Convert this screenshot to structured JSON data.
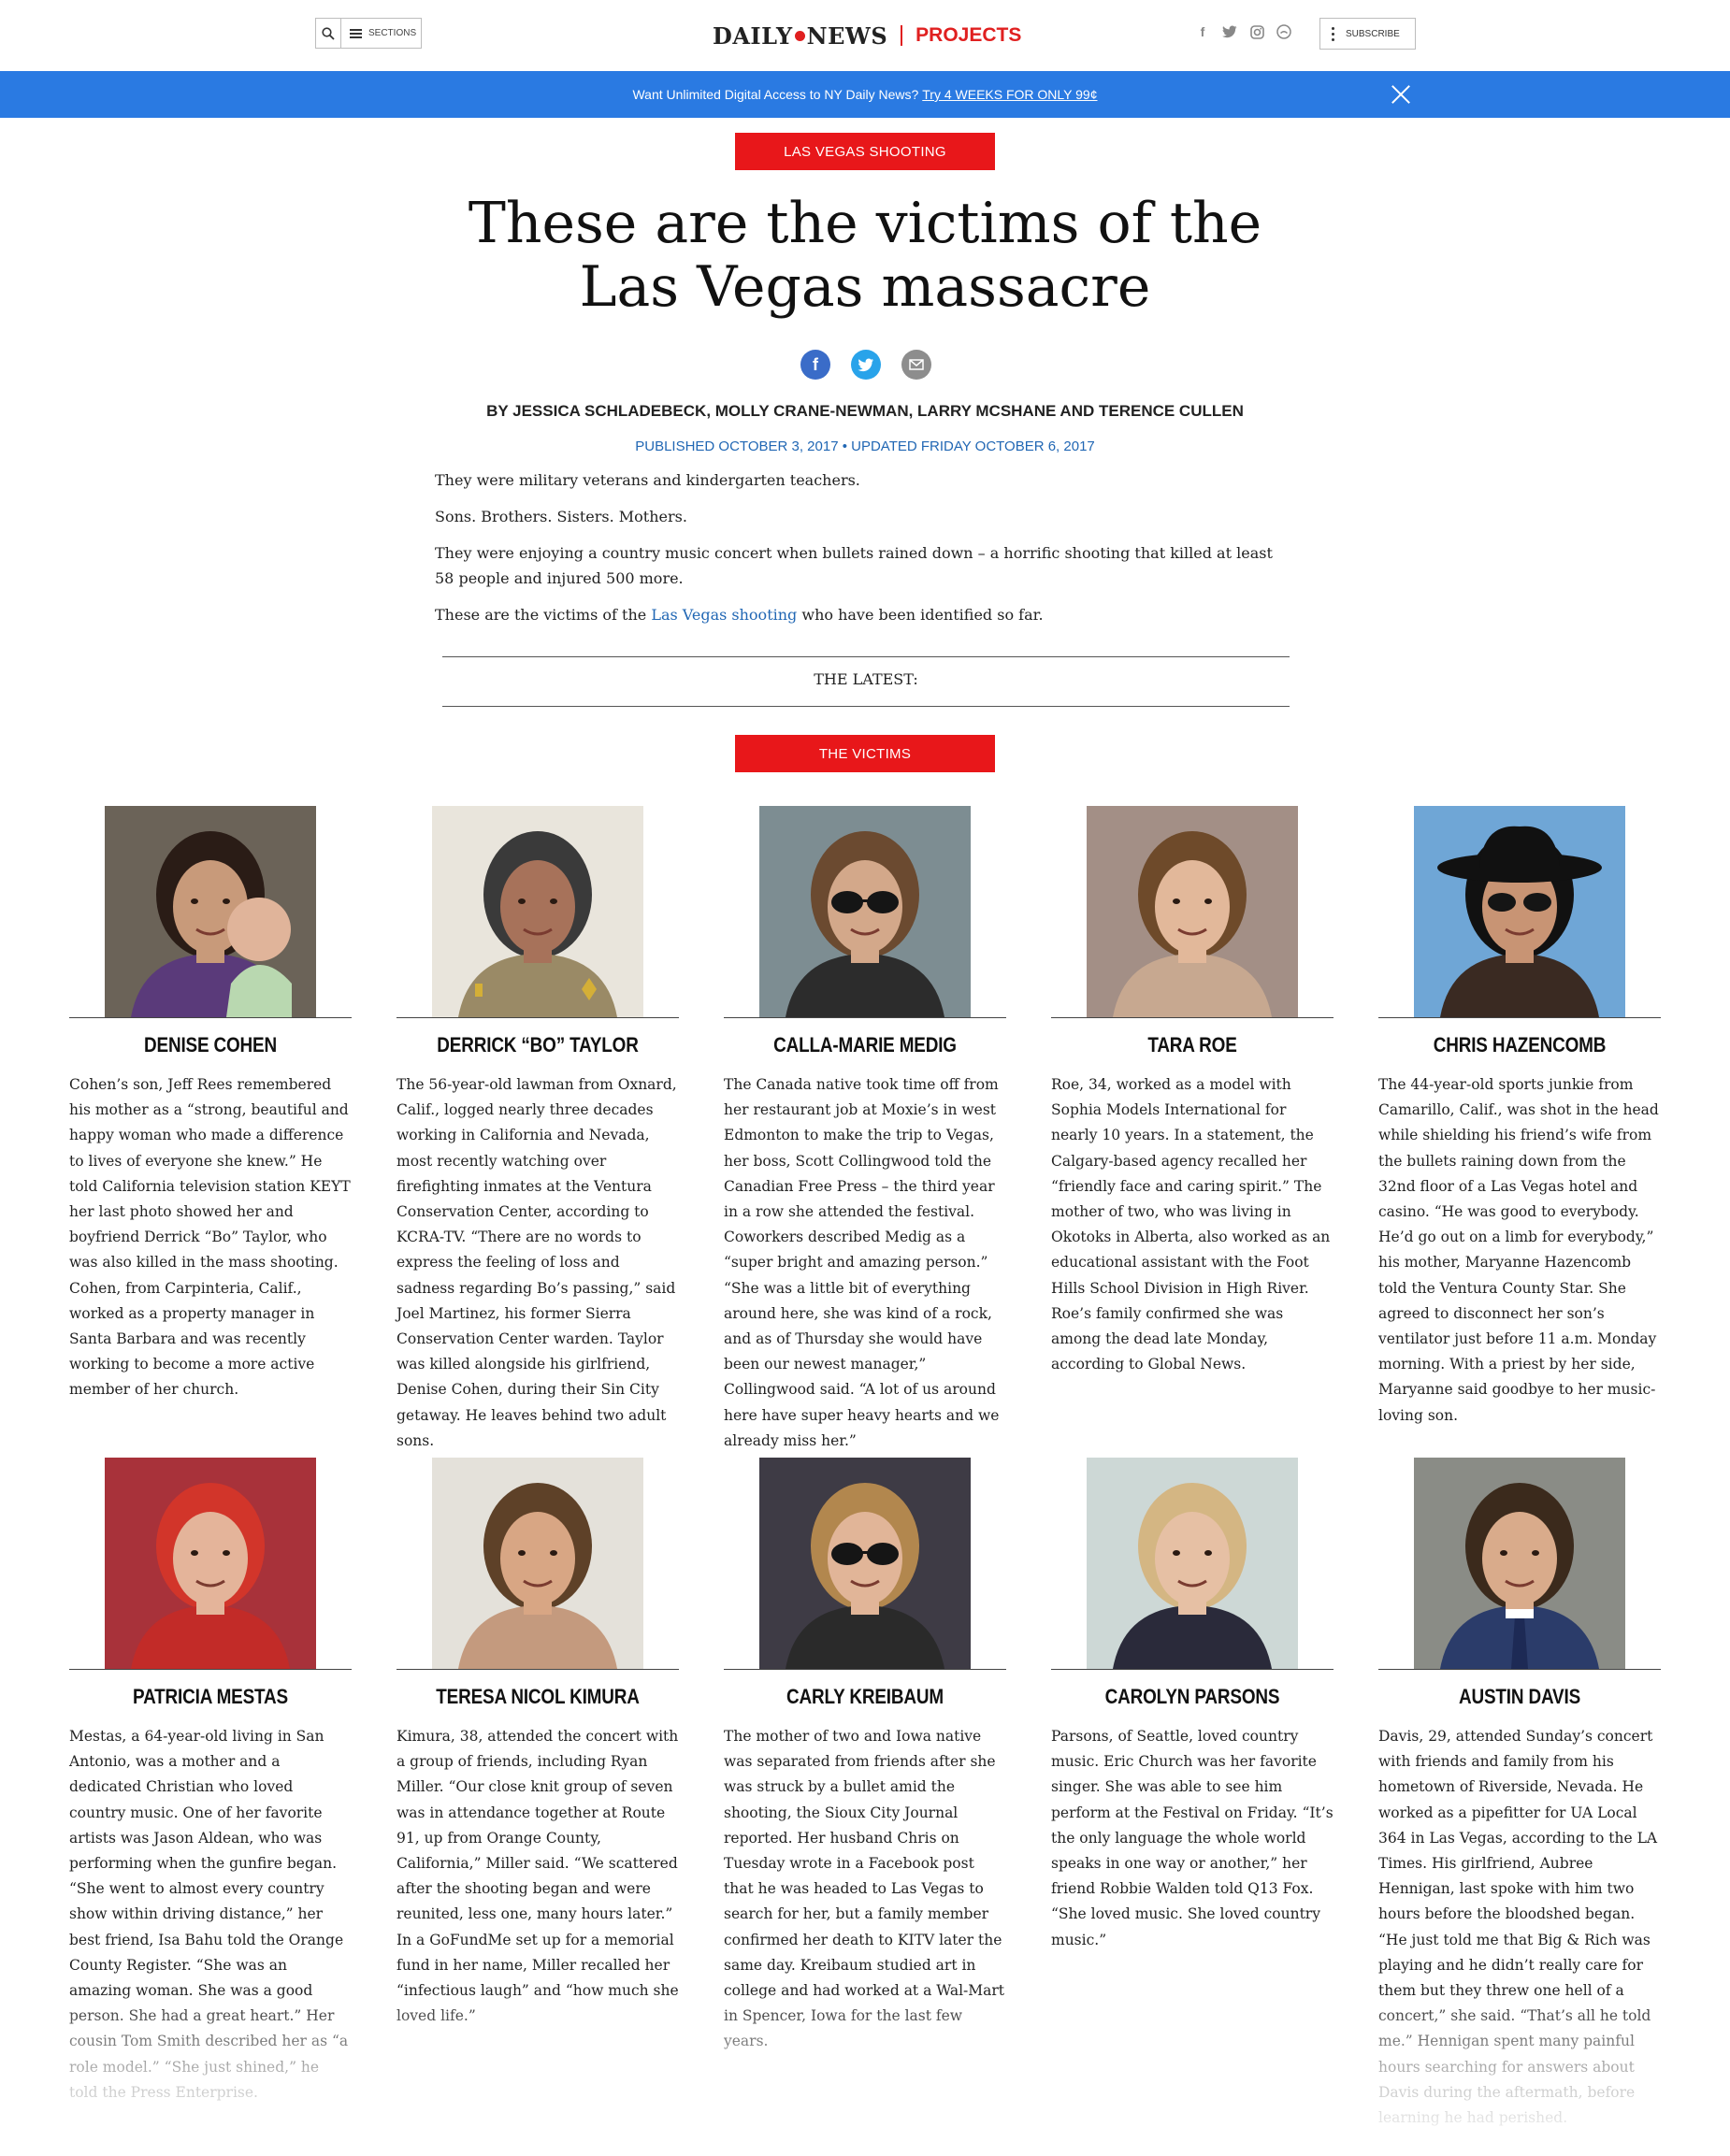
{
  "header": {
    "sections_label": "SECTIONS",
    "logo_left": "DAILY",
    "logo_right": "NEWS",
    "projects_label": "PROJECTS",
    "subscribe_label": "SUBSCRIBE",
    "social": [
      "facebook-icon",
      "twitter-icon",
      "instagram-icon",
      "other-icon"
    ]
  },
  "promo": {
    "text": "Want Unlimited Digital Access to NY Daily News?",
    "link": "Try 4 WEEKS FOR ONLY 99¢"
  },
  "article": {
    "tag": "LAS VEGAS SHOOTING",
    "headline_line1": "These are the victims of the",
    "headline_line2": "Las Vegas massacre",
    "byline": "BY JESSICA SCHLADEBECK, MOLLY CRANE-NEWMAN, LARRY MCSHANE AND TERENCE CULLEN",
    "dateline": "PUBLISHED OCTOBER 3, 2017 • UPDATED FRIDAY OCTOBER 6, 2017",
    "intro": {
      "p1": "They were military veterans and kindergarten teachers.",
      "p2": "Sons. Brothers. Sisters. Mothers.",
      "p3": "They were enjoying a country music concert when bullets rained down – a horrific shooting that killed at least 58 people and injured 500 more.",
      "p4_before": "These are the victims of the ",
      "p4_link": "Las Vegas shooting",
      "p4_after": " who have been identified so far."
    },
    "latest_label": "THE LATEST:",
    "victims_tag": "THE VICTIMS"
  },
  "colors": {
    "brand_red": "#e8171a",
    "banner_blue": "#2a7ae2",
    "link_blue": "#2167b4"
  },
  "victims": [
    {
      "name": "DENISE COHEN",
      "bio": "Cohen’s son, Jeff Rees remembered his mother as a “strong, beautiful and happy woman who made a difference to lives of everyone she knew.” He told California television station KEYT her last photo showed her and boyfriend Derrick “Bo” Taylor, who was also killed in the mass shooting. Cohen, from Carpinteria, Calif., worked as a property manager in Santa Barbara and was recently working to become a more active member of her church."
    },
    {
      "name": "DERRICK “BO” TAYLOR",
      "bio": "The 56-year-old lawman from Oxnard, Calif., logged nearly three decades working in California and Nevada, most recently watching over firefighting inmates at the Ventura Conservation Center, according to KCRA-TV. “There are no words to express the feeling of loss and sadness regarding Bo’s passing,” said Joel Martinez, his former Sierra Conservation Center warden. Taylor was killed alongside his girlfriend, Denise Cohen, during their Sin City getaway. He leaves behind two adult sons."
    },
    {
      "name": "CALLA-MARIE MEDIG",
      "bio": "The Canada native took time off from her restaurant job at Moxie’s in west Edmonton to make the trip to Vegas, her boss, Scott Collingwood told the Canadian Free Press – the third year in a row she attended the festival. Coworkers described Medig as a “super bright and amazing person.” “She was a little bit of everything around here, she was kind of a rock, and as of Thursday she would have been our newest manager,” Collingwood said. “A lot of us around here have super heavy hearts and we already miss her.”"
    },
    {
      "name": "TARA ROE",
      "bio": "Roe, 34, worked as a model with Sophia Models International for nearly 10 years. In a statement, the Calgary-based agency recalled her “friendly face and caring spirit.” The mother of two, who was living in Okotoks in Alberta, also worked as an educational assistant with the Foot Hills School Division in High River. Roe’s family confirmed she was among the dead late Monday, according to Global News."
    },
    {
      "name": "CHRIS HAZENCOMB",
      "bio": "The 44-year-old sports junkie from Camarillo, Calif., was shot in the head while shielding his friend’s wife from the bullets raining down from the 32nd floor of a Las Vegas hotel and casino. “He was good to everybody. He’d go out on a limb for everybody,” his mother, Maryanne Hazencomb told the Ventura County Star. She agreed to disconnect her son’s ventilator just before 11 a.m. Monday morning. With a priest by her side, Maryanne said goodbye to her music-loving son."
    },
    {
      "name": "PATRICIA MESTAS",
      "bio": "Mestas, a 64-year-old living in San Antonio, was a mother and a dedicated Christian who loved country music. One of her favorite artists was Jason Aldean, who was performing when the gunfire began. “She went to almost every country show within driving distance,” her best friend, Isa Bahu told the Orange County Register. “She was an amazing woman. She was a good person. She had a great heart.” Her cousin Tom Smith described her as “a role model.” “She just shined,” he told the Press Enterprise."
    },
    {
      "name": "TERESA NICOL KIMURA",
      "bio": "Kimura, 38, attended the concert with a group of friends, including Ryan Miller. “Our close knit group of seven was in attendance together at Route 91, up from Orange County, California,” Miller said. “We scattered after the shooting began and were reunited, less one, many hours later.” In a GoFundMe set up for a memorial fund in her name, Miller recalled her “infectious laugh” and “how much she loved life.”"
    },
    {
      "name": "CARLY KREIBAUM",
      "bio": "The mother of two and Iowa native was separated from friends after she was struck by a bullet amid the shooting, the Sioux City Journal reported. Her husband Chris on Tuesday wrote in a Facebook post that he was headed to Las Vegas to search for her, but a family member confirmed her death to KITV later the same day. Kreibaum studied art in college and had worked at a Wal-Mart in Spencer, Iowa for the last few years."
    },
    {
      "name": "CAROLYN PARSONS",
      "bio": "Parsons, of Seattle, loved country music. Eric Church was her favorite singer. She was able to see him perform at the Festival on Friday. “It’s the only language the whole world speaks in one way or another,” her friend Robbie Walden told Q13 Fox. “She loved music. She loved country music.”"
    },
    {
      "name": "AUSTIN DAVIS",
      "bio": "Davis, 29, attended Sunday’s concert with friends and family from his hometown of Riverside, Nevada. He worked as a pipefitter for UA Local 364 in Las Vegas, according to the LA Times. His girlfriend, Aubree Hennigan, last spoke with him two hours before the bloodshed began. “He just told me that Big & Rich was playing and he didn’t really care for them but they threw one hell of a concert,” she said. “That’s all he told me.” Hennigan spent many painful hours searching for answers about Davis during the aftermath, before learning he had perished."
    }
  ]
}
